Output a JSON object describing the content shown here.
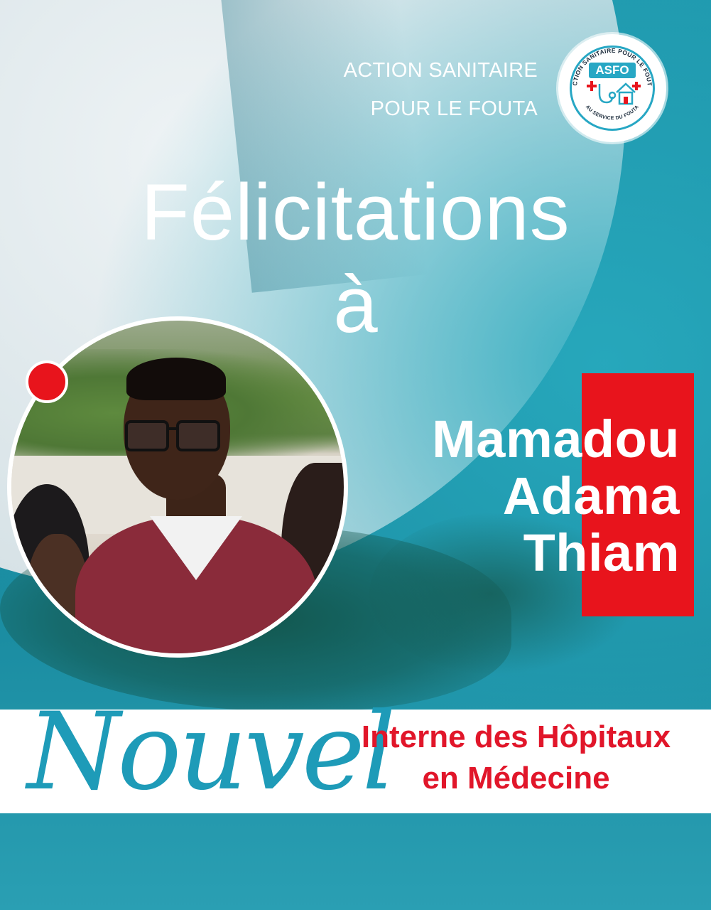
{
  "organization": {
    "name_line1": "ACTION SANITAIRE",
    "name_line2": "POUR LE FOUTA",
    "logo": {
      "abbreviation": "ASFO",
      "ring_top_text": "ACTION SANITAIRE POUR LE FOUTA",
      "ring_bottom_text": "AU SERVICE DU FOUTA",
      "icons": [
        "stethoscope-icon",
        "house-icon",
        "red-cross-icon"
      ]
    }
  },
  "headline": {
    "line1": "Félicitations",
    "line2": "à"
  },
  "honoree": {
    "first_name": "Mamadou",
    "middle_name": "Adama",
    "last_name": "Thiam"
  },
  "banner": {
    "script_word": "Nouvel",
    "role_line1": "Interne des Hôpitaux",
    "role_line2": "en Médecine"
  },
  "colors": {
    "teal": "#1e9bb8",
    "red": "#e8141c",
    "white": "#ffffff"
  }
}
